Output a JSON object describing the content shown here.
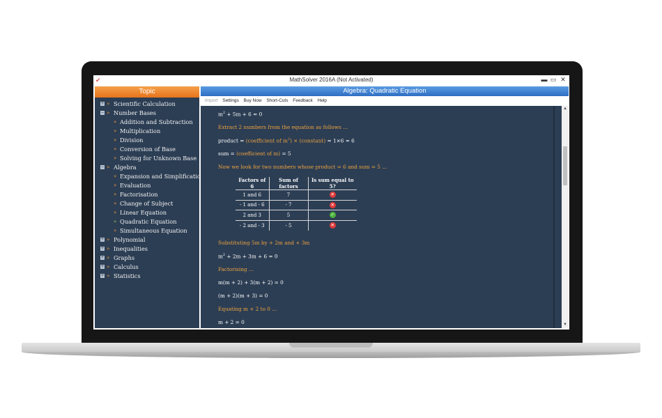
{
  "window": {
    "title": "MathSolver 2016A (Not Activated)",
    "minimize": "▬",
    "maximize": "▭",
    "close": "✕"
  },
  "topic_panel": {
    "header": "Topic",
    "items": [
      {
        "label": "Scientific Calculation",
        "level": 0,
        "toggle": "+"
      },
      {
        "label": "Number Bases",
        "level": 0,
        "toggle": "−"
      },
      {
        "label": "Addition and Subtraction",
        "level": 1
      },
      {
        "label": "Multiplication",
        "level": 1
      },
      {
        "label": "Division",
        "level": 1
      },
      {
        "label": "Conversion of Base",
        "level": 1
      },
      {
        "label": "Solving for Unknown Base",
        "level": 1
      },
      {
        "label": "Algebra",
        "level": 0,
        "toggle": "−"
      },
      {
        "label": "Expansion and Simplification",
        "level": 1
      },
      {
        "label": "Evaluation",
        "level": 1
      },
      {
        "label": "Factorisation",
        "level": 1
      },
      {
        "label": "Change of Subject",
        "level": 1
      },
      {
        "label": "Linear Equation",
        "level": 1
      },
      {
        "label": "Quadratic Equation",
        "level": 1,
        "active": true
      },
      {
        "label": "Simultaneous Equation",
        "level": 1
      },
      {
        "label": "Polynomial",
        "level": 0,
        "toggle": "+"
      },
      {
        "label": "Inequalities",
        "level": 0,
        "toggle": "+"
      },
      {
        "label": "Graphs",
        "level": 0,
        "toggle": "+"
      },
      {
        "label": "Calculus",
        "level": 0,
        "toggle": "+"
      },
      {
        "label": "Statistics",
        "level": 0,
        "toggle": "+"
      }
    ]
  },
  "content_panel": {
    "header": "Algebra: Quadratic Equation",
    "menu": [
      "Import",
      "Settings",
      "Buy Now",
      "Short-Cuts",
      "Feedback",
      "Help"
    ],
    "lines": {
      "l1": "m",
      "l1_sup": "2",
      "l1_rest": " + 5m + 6 = 0",
      "l2": "Extract 2 numbers from the equation as follows ...",
      "l3_a": "product = ",
      "l3_b": "(coefficient of m",
      "l3_sup": "2",
      "l3_c": ") × (constant)",
      "l3_d": " = 1×6 = 6",
      "l4_a": "sum = ",
      "l4_b": "(coefficient of m)",
      "l4_c": " = 5",
      "l5": "Now we look for two numbers whose product = 6 and sum = 5 ...",
      "l6": "Substituting 5m by + 2m and + 3m",
      "l7": "m",
      "l7_sup": "2",
      "l7_rest": " + 2m + 3m + 6 = 0",
      "l8": "Factorising ...",
      "l9": "m(m + 2) + 3(m + 2) = 0",
      "l10": "(m + 2)(m + 3) = 0",
      "l11": "Equating m + 2 to 0 ...",
      "l12": "m + 2 = 0"
    },
    "table": {
      "headers": [
        "Factors of 6",
        "Sum of factors",
        "Is sum equal to 5?"
      ],
      "rows": [
        {
          "factors": "1 and 6",
          "sum": "7",
          "equal": "no"
        },
        {
          "factors": "- 1 and - 6",
          "sum": "- 7",
          "equal": "no"
        },
        {
          "factors": "2 and 3",
          "sum": "5",
          "equal": "yes"
        },
        {
          "factors": "- 2 and - 3",
          "sum": "- 5",
          "equal": "no"
        }
      ],
      "yes_glyph": "✓",
      "no_glyph": "✕"
    }
  },
  "colors": {
    "panel_bg": "#2c3e54",
    "topic_header": "#e7731c",
    "section_header": "#2f6fc3",
    "orange_text": "#f0a33e"
  }
}
